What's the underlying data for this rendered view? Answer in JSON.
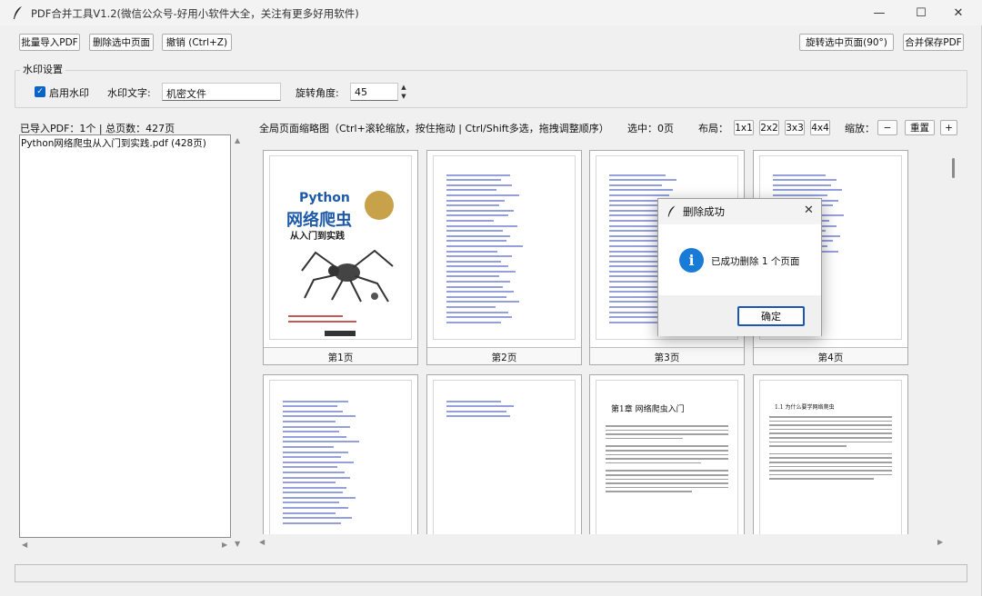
{
  "window": {
    "title": "PDF合并工具V1.2(微信公众号-好用小软件大全，关注有更多好用软件)",
    "minimize": "—",
    "maximize": "☐",
    "close": "✕"
  },
  "toolbar": {
    "batch_import": "批量导入PDF",
    "delete_selected": "删除选中页面",
    "undo": "撤销 (Ctrl+Z)",
    "rotate_selected": "旋转选中页面(90°)",
    "merge_save": "合并保存PDF"
  },
  "watermark": {
    "group_label": "水印设置",
    "enable_label": "启用水印",
    "enabled": true,
    "text_label": "水印文字:",
    "text_value": "机密文件",
    "angle_label": "旋转角度:",
    "angle_value": "45"
  },
  "left_panel": {
    "summary": "已导入PDF：1个 | 总页数：427页",
    "files": [
      "Python网络爬虫从入门到实践.pdf (428页)"
    ]
  },
  "thumbs_header": {
    "hint": "全局页面缩略图（Ctrl+滚轮缩放，按住拖动 | Ctrl/Shift多选，拖拽调整顺序）",
    "selected": "选中：0页",
    "layout_label": "布局：",
    "layouts": [
      "1x1",
      "2x2",
      "3x3",
      "4x4"
    ],
    "zoom_label": "缩放：",
    "zoom_out": "−",
    "reset": "重置",
    "zoom_in": "+"
  },
  "pages": [
    {
      "label": "第1页"
    },
    {
      "label": "第2页"
    },
    {
      "label": "第3页"
    },
    {
      "label": "第4页"
    }
  ],
  "cover": {
    "title_en": "Python",
    "title_cn": "网络爬虫",
    "subtitle": "从入门到实践"
  },
  "chapter_page": {
    "heading": "第1章 网络爬虫入门",
    "section": "1.1 为什么要学网络爬虫"
  },
  "dialog": {
    "title": "删除成功",
    "message": "已成功删除 1 个页面",
    "ok": "确定",
    "close": "✕"
  }
}
